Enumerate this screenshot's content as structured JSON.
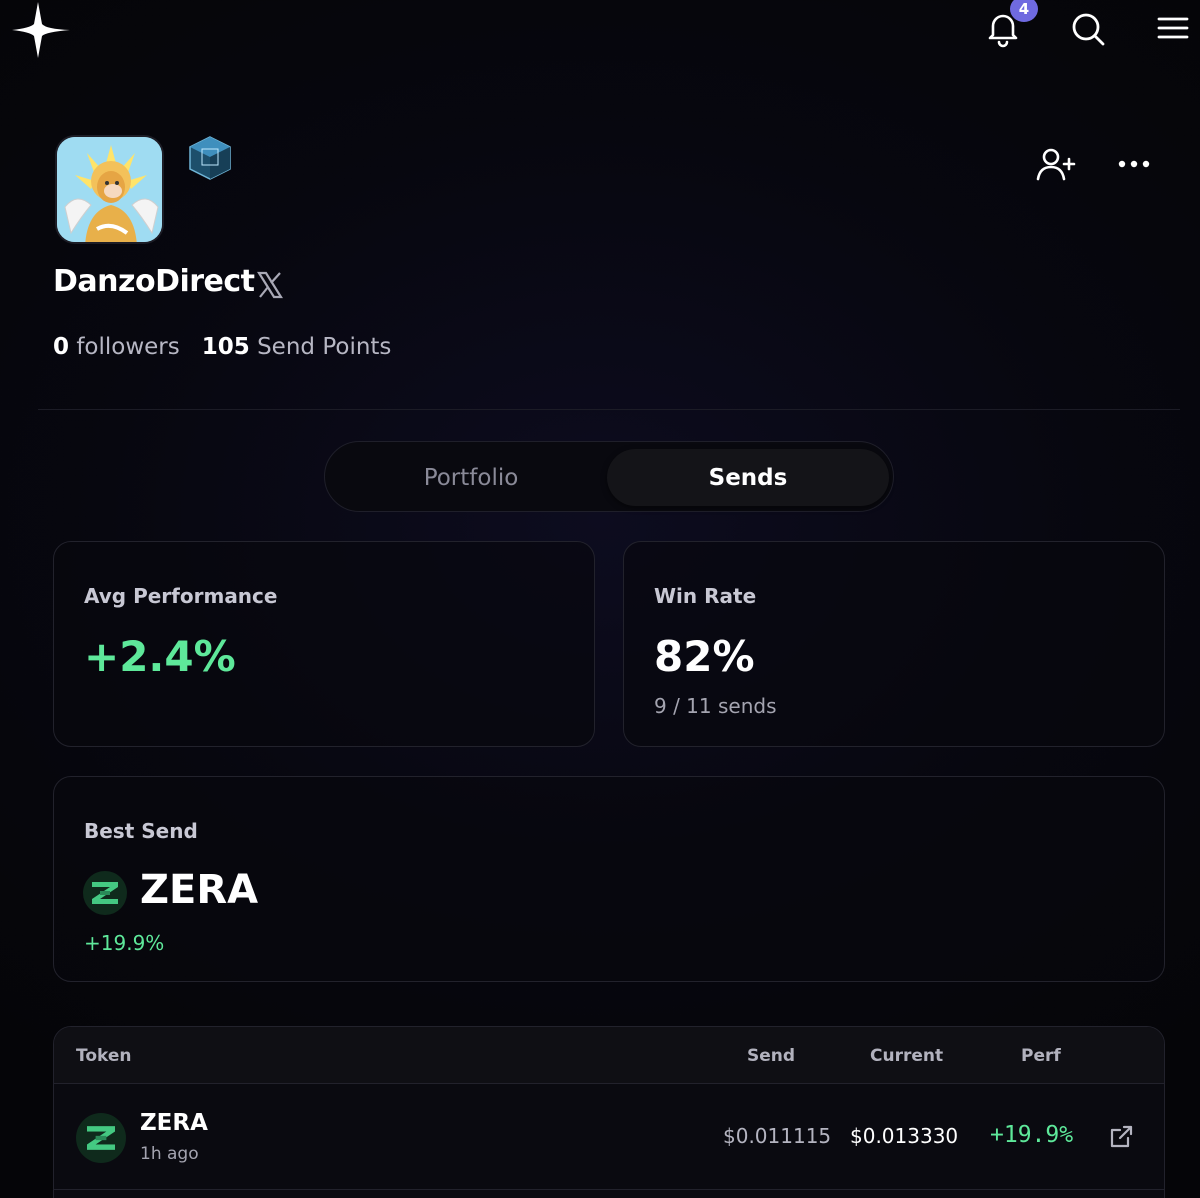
{
  "header": {
    "notification_count": "4"
  },
  "profile": {
    "username": "DanzoDirect",
    "followers_count": "0",
    "followers_label": "followers",
    "points_count": "105",
    "points_label": "Send Points"
  },
  "tabs": [
    {
      "label": "Portfolio",
      "active": false
    },
    {
      "label": "Sends",
      "active": true
    }
  ],
  "stats": {
    "avg_label": "Avg Performance",
    "avg_value": "+2.4%",
    "win_label": "Win Rate",
    "win_value": "82%",
    "win_sub": "9 / 11 sends"
  },
  "best_send": {
    "label": "Best Send",
    "token": "ZERA",
    "perf": "+19.9%"
  },
  "table": {
    "columns": [
      "Token",
      "Send",
      "Current",
      "Perf"
    ],
    "rows": [
      {
        "token": "ZERA",
        "time": "1h ago",
        "send": "$0.011115",
        "current": "$0.013330",
        "perf": "+19.9%"
      }
    ]
  },
  "colors": {
    "accent_green": "#5ee89a",
    "badge_purple": "#6f6ae0",
    "background": "#07070f"
  },
  "icons": [
    "logo-star-icon",
    "bell-icon",
    "search-icon",
    "menu-icon",
    "gem-badge-icon",
    "add-user-icon",
    "more-icon",
    "x-logo-icon",
    "zera-token-icon",
    "external-link-icon"
  ]
}
